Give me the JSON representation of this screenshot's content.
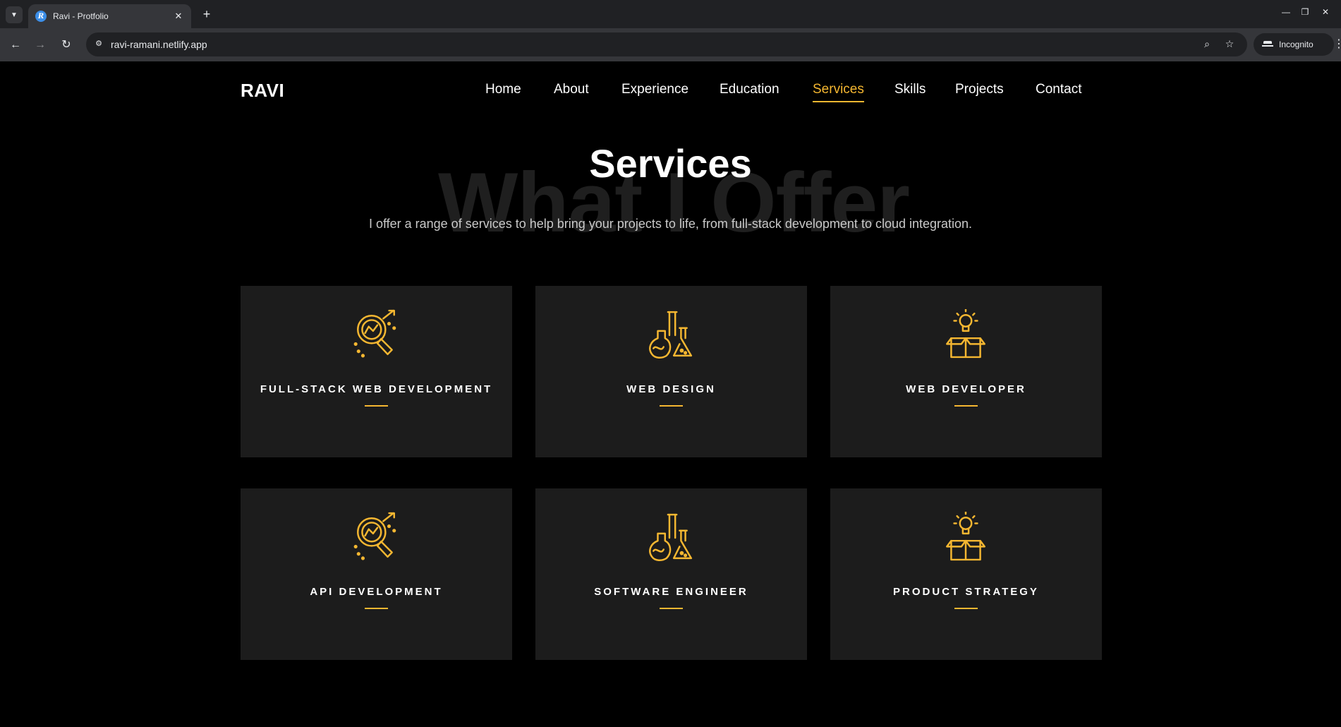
{
  "browser": {
    "tab_title": "Ravi - Protfolio",
    "favicon_letter": "R",
    "new_tab_symbol": "+",
    "close_symbol": "✕",
    "url": "ravi-ramani.netlify.app",
    "incognito_label": "Incognito"
  },
  "site": {
    "logo": "RAVI",
    "nav": [
      {
        "label": "Home"
      },
      {
        "label": "About"
      },
      {
        "label": "Experience"
      },
      {
        "label": "Education"
      },
      {
        "label": "Services",
        "active": true
      },
      {
        "label": "Skills"
      },
      {
        "label": "Projects"
      },
      {
        "label": "Contact"
      }
    ]
  },
  "services": {
    "background_word": "What I Offer",
    "title": "Services",
    "subtitle": "I offer a range of services to help bring your projects to life, from full-stack development to cloud integration.",
    "cards": [
      {
        "title": "FULL-STACK WEB DEVELOPMENT",
        "icon": "magnifier-chart-icon"
      },
      {
        "title": "WEB DESIGN",
        "icon": "flasks-icon"
      },
      {
        "title": "WEB DEVELOPER",
        "icon": "bulb-box-icon"
      },
      {
        "title": "API DEVELOPMENT",
        "icon": "magnifier-chart-icon"
      },
      {
        "title": "SOFTWARE ENGINEER",
        "icon": "flasks-icon"
      },
      {
        "title": "PRODUCT STRATEGY",
        "icon": "bulb-box-icon"
      }
    ]
  },
  "colors": {
    "accent": "#f5b731",
    "card_bg": "#1c1c1c",
    "page_bg": "#000000"
  }
}
